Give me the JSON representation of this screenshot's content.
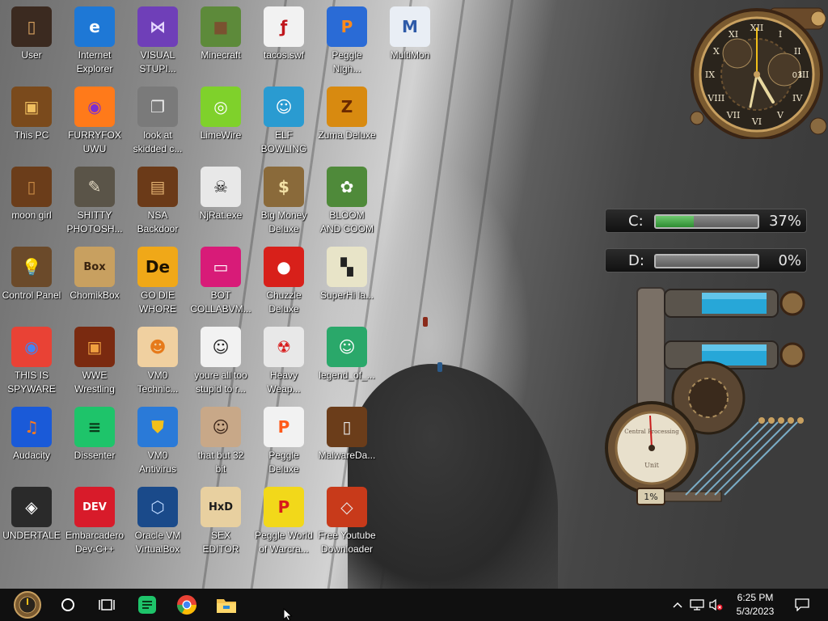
{
  "desktop": {
    "icons": [
      {
        "label": "User",
        "glyph": "▯",
        "bg": "#3b2a20",
        "fg": "#d9a25f",
        "icon": "user-folder-icon"
      },
      {
        "label": "Internet\nExplorer",
        "glyph": "e",
        "bg": "#1e78d6",
        "fg": "#ffffff",
        "icon": "internet-explorer-icon"
      },
      {
        "label": "VISUAL\nSTUPI...",
        "glyph": "⋈",
        "bg": "#6f3fb8",
        "fg": "#e6d8ff",
        "icon": "visual-studio-icon"
      },
      {
        "label": "Minecraft",
        "glyph": "■",
        "bg": "#5d8a3a",
        "fg": "#7a5230",
        "icon": "minecraft-icon"
      },
      {
        "label": "tacos.swf",
        "glyph": "ƒ",
        "bg": "#f2f2f2",
        "fg": "#c0161c",
        "icon": "flash-file-icon"
      },
      {
        "label": "Peggle\nNigh...",
        "glyph": "P",
        "bg": "#2a6bd6",
        "fg": "#ff8a1c",
        "icon": "peggle-nights-icon"
      },
      {
        "label": "MultiMon",
        "glyph": "M",
        "bg": "#e9eef5",
        "fg": "#2e5aa8",
        "icon": "multimon-icon"
      },
      {
        "label": "This PC",
        "glyph": "▣",
        "bg": "#7a4a1c",
        "fg": "#f0c060",
        "icon": "this-pc-icon"
      },
      {
        "label": "FURRYFOX\nUWU",
        "glyph": "◉",
        "bg": "#ff7a1a",
        "fg": "#7b2fd0",
        "icon": "firefox-icon"
      },
      {
        "label": "look at\nskidded c...",
        "glyph": "❐",
        "bg": "#7a7a7a",
        "fg": "#ececec",
        "icon": "file-stack-icon"
      },
      {
        "label": "LimeWire",
        "glyph": "◎",
        "bg": "#7fd12b",
        "fg": "#ffffff",
        "icon": "limewire-icon"
      },
      {
        "label": "ELF\nBOWLING",
        "glyph": "☺",
        "bg": "#2a9bd1",
        "fg": "#ffffff",
        "icon": "elf-bowling-icon"
      },
      {
        "label": "Zuma Deluxe",
        "glyph": "Z",
        "bg": "#d88a10",
        "fg": "#6b2a00",
        "icon": "zuma-deluxe-icon"
      },
      {
        "label": "moon girl",
        "glyph": "▯",
        "bg": "#6b3d1a",
        "fg": "#c98a45",
        "icon": "moon-girl-folder-icon"
      },
      {
        "label": "SHITTY\nPHOTOSH...",
        "glyph": "✎",
        "bg": "#5a5448",
        "fg": "#e0d6c0",
        "icon": "gimp-icon"
      },
      {
        "label": "NSA\nBackdoor",
        "glyph": "▤",
        "bg": "#6b3a18",
        "fg": "#e1b070",
        "icon": "nsa-backdoor-icon"
      },
      {
        "label": "NjRat.exe",
        "glyph": "☠",
        "bg": "#e8e8e8",
        "fg": "#111111",
        "icon": "skull-icon"
      },
      {
        "label": "Big Money\nDeluxe",
        "glyph": "$",
        "bg": "#8a6a3a",
        "fg": "#f3e1a6",
        "icon": "money-bag-icon"
      },
      {
        "label": "BLOOM\nAND COOM",
        "glyph": "✿",
        "bg": "#4f8a3a",
        "fg": "#ffffff",
        "icon": "bloom-flower-icon"
      },
      {
        "label": "Control Panel",
        "glyph": "💡",
        "bg": "#6b4a2a",
        "fg": "#f2d06a",
        "icon": "control-panel-icon"
      },
      {
        "label": "ChomikBox",
        "glyph": "Box",
        "bg": "#c8a060",
        "fg": "#3a2410",
        "icon": "chomikbox-icon"
      },
      {
        "label": "GO DIE\nWHORE",
        "glyph": "De",
        "bg": "#f0a818",
        "fg": "#1c1200",
        "icon": "dev-editor-icon"
      },
      {
        "label": "BOT\nCOLLABVM...",
        "glyph": "▭",
        "bg": "#d81b78",
        "fg": "#ffffff",
        "icon": "collabvm-icon"
      },
      {
        "label": "Chuzzle\nDeluxe",
        "glyph": "●",
        "bg": "#d8201a",
        "fg": "#ffffff",
        "icon": "chuzzle-icon"
      },
      {
        "label": "SuperHi la...",
        "glyph": "▚",
        "bg": "#e8e4c8",
        "fg": "#222222",
        "icon": "pixel-dog-icon"
      },
      {
        "label": "THIS IS\nSPYWARE",
        "glyph": "◉",
        "bg": "#e94235",
        "fg": "#4285f4",
        "icon": "chrome-icon"
      },
      {
        "label": "WWE\nWrestling",
        "glyph": "▣",
        "bg": "#7a2a10",
        "fg": "#f0a040",
        "icon": "wwe-wrestling-icon"
      },
      {
        "label": "VM0\nTechnic...",
        "glyph": "☻",
        "bg": "#f0d0a0",
        "fg": "#e67a1a",
        "icon": "technician-icon"
      },
      {
        "label": "youre all too\nstupid to r...",
        "glyph": "☺",
        "bg": "#f2f2f2",
        "fg": "#222222",
        "icon": "portrait-sketch-icon"
      },
      {
        "label": "Heavy\nWeap...",
        "glyph": "☢",
        "bg": "#e8e8e8",
        "fg": "#d81b1b",
        "icon": "radiation-icon"
      },
      {
        "label": "legend_of_...",
        "glyph": "☺",
        "bg": "#2aa86a",
        "fg": "#ffffff",
        "icon": "legend-character-icon"
      },
      {
        "label": "Audacity",
        "glyph": "♫",
        "bg": "#1a5ad8",
        "fg": "#ff7a1a",
        "icon": "audacity-icon"
      },
      {
        "label": "Dissenter",
        "glyph": "≡",
        "bg": "#1ec46a",
        "fg": "#0a3a1a",
        "icon": "dissenter-icon"
      },
      {
        "label": "VM0\nAntivirus",
        "glyph": "⛊",
        "bg": "#2a7ad8",
        "fg": "#f2c01a",
        "icon": "shield-icon"
      },
      {
        "label": "that but 32\nbit",
        "glyph": "☺",
        "bg": "#c8a888",
        "fg": "#3a2418",
        "icon": "portrait-painting-icon"
      },
      {
        "label": "Peggle\nDeluxe",
        "glyph": "P",
        "bg": "#f2f2f2",
        "fg": "#ff5a1a",
        "icon": "peggle-deluxe-icon"
      },
      {
        "label": "MalwareDa...",
        "glyph": "▯",
        "bg": "#6b3d1a",
        "fg": "#e8e8e8",
        "icon": "malware-folder-icon"
      },
      {
        "label": "UNDERTALE",
        "glyph": "◈",
        "bg": "#2a2a2a",
        "fg": "#ffffff",
        "icon": "unity-icon"
      },
      {
        "label": "Embarcadero\nDev-C++",
        "glyph": "DEV",
        "bg": "#d81b2a",
        "fg": "#ffffff",
        "icon": "dev-cpp-icon"
      },
      {
        "label": "Oracle VM\nVirtualBox",
        "glyph": "⬡",
        "bg": "#1a4a8a",
        "fg": "#bcd8ff",
        "icon": "virtualbox-icon"
      },
      {
        "label": "SEX\nEDITOR",
        "glyph": "HxD",
        "bg": "#e8d0a0",
        "fg": "#1a1a1a",
        "icon": "hex-editor-icon"
      },
      {
        "label": "Peggle World\nof Warcra...",
        "glyph": "P",
        "bg": "#f2d81a",
        "fg": "#d81b1b",
        "icon": "peggle-wow-icon"
      },
      {
        "label": "Free Youtube\nDownloader",
        "glyph": "◇",
        "bg": "#c83a1a",
        "fg": "#e8e8e8",
        "icon": "youtube-downloader-icon"
      }
    ]
  },
  "gadgets": {
    "clock": {
      "numerals": [
        "XII",
        "III",
        "VI",
        "IX",
        "I",
        "II",
        "IV",
        "V",
        "VII",
        "VIII",
        "X",
        "XI"
      ],
      "date": "03"
    },
    "drives": [
      {
        "label": "C:",
        "percent": "37%",
        "fill": 0.37
      },
      {
        "label": "D:",
        "percent": "0%",
        "fill": 0.0
      }
    ],
    "gauge": {
      "title": "Central\nProcessing",
      "unit": "Unit",
      "percent": "1%"
    }
  },
  "taskbar": {
    "pinned": [
      {
        "name": "start-button",
        "icon": "steampunk-start-icon"
      },
      {
        "name": "cortana-button",
        "icon": "circle-icon"
      },
      {
        "name": "task-view-button",
        "icon": "task-view-icon"
      },
      {
        "name": "dissenter-taskbar",
        "icon": "dissenter-icon"
      },
      {
        "name": "chrome-taskbar",
        "icon": "chrome-icon"
      },
      {
        "name": "file-explorer-taskbar",
        "icon": "folder-icon"
      }
    ],
    "clock": {
      "time": "6:25 PM",
      "date": "5/3/2023"
    }
  }
}
